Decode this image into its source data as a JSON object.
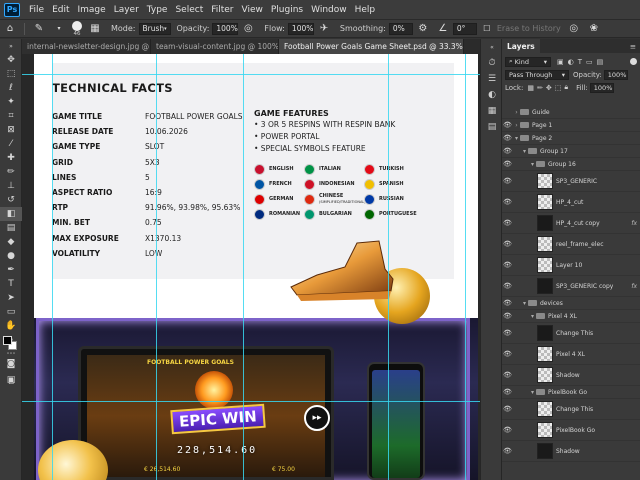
{
  "app": {
    "logo": "Ps"
  },
  "menu": [
    "File",
    "Edit",
    "Image",
    "Layer",
    "Type",
    "Select",
    "Filter",
    "View",
    "Plugins",
    "Window",
    "Help"
  ],
  "options": {
    "brush_size": "46",
    "mode_label": "Mode:",
    "mode_value": "Brush",
    "opacity_label": "Opacity:",
    "opacity_value": "100%",
    "flow_label": "Flow:",
    "flow_value": "100%",
    "smoothing_label": "Smoothing:",
    "smoothing_value": "0%",
    "angle_value": "0°",
    "erase_history": "Erase to History"
  },
  "tabs": [
    {
      "label": "internal-newsletter-design.jpg @ 100%..."
    },
    {
      "label": "team-visual-content.jpg @ 100% (RGB/..."
    },
    {
      "label": "Football Power Goals Game Sheet.psd @ 33.3% (RGB/16)"
    }
  ],
  "document": {
    "title": "TECHNICAL FACTS",
    "facts": [
      {
        "key": "GAME TITLE",
        "value": "FOOTBALL POWER GOALS"
      },
      {
        "key": "RELEASE DATE",
        "value": "10.06.2026"
      },
      {
        "key": "GAME TYPE",
        "value": "SLOT"
      },
      {
        "key": "GRID",
        "value": "5X3"
      },
      {
        "key": "LINES",
        "value": "5"
      },
      {
        "key": "ASPECT RATIO",
        "value": "16:9"
      },
      {
        "key": "RTP",
        "value": "91.96%, 93.98%, 95.63%"
      },
      {
        "key": "MIN. BET",
        "value": "0.75"
      },
      {
        "key": "MAX EXPOSURE",
        "value": "X1370.13"
      },
      {
        "key": "VOLATILITY",
        "value": "LOW"
      }
    ],
    "features_title": "GAME FEATURES",
    "features": [
      "• 3 OR 5 RESPINS WITH RESPIN BANK",
      "• POWER PORTAL",
      "• SPECIAL SYMBOLS FEATURE"
    ],
    "languages": [
      {
        "name": "ENGLISH",
        "color": "#c8102e"
      },
      {
        "name": "ITALIAN",
        "color": "#009246"
      },
      {
        "name": "TURKISH",
        "color": "#e30a17"
      },
      {
        "name": "FRENCH",
        "color": "#0055a4"
      },
      {
        "name": "INDONESIAN",
        "color": "#ce1126"
      },
      {
        "name": "SPANISH",
        "color": "#f1bf00"
      },
      {
        "name": "GERMAN",
        "color": "#dd0000"
      },
      {
        "name": "CHINESE",
        "color": "#de2910"
      },
      {
        "name": "RUSSIAN",
        "color": "#0039a6"
      },
      {
        "name": "ROMANIAN",
        "color": "#002b7f"
      },
      {
        "name": "BULGARIAN",
        "color": "#00966e"
      },
      {
        "name": "PORTUGUESE",
        "color": "#006600"
      }
    ],
    "chinese_sub": "(SIMPLIFIED/TRADITIONAL)",
    "game": {
      "logo_text": "FOOTBALL POWER GOALS",
      "epic_win": "EPIC WIN",
      "jackpot": "228,514.60",
      "bet_left": "€ 26,514.60",
      "bet_right": "€ 75.00"
    }
  },
  "layers_panel": {
    "tab": "Layers",
    "kind_label": "Kind",
    "blend_mode": "Pass Through",
    "opacity_label": "Opacity:",
    "opacity_value": "100%",
    "lock_label": "Lock:",
    "fill_label": "Fill:",
    "fill_value": "100%",
    "layers": [
      {
        "name": "Guide",
        "type": "folder",
        "indent": 0,
        "visible": false
      },
      {
        "name": "Page 1",
        "type": "folder",
        "indent": 0,
        "visible": true
      },
      {
        "name": "Page 2",
        "type": "folder",
        "indent": 0,
        "visible": true,
        "open": true
      },
      {
        "name": "Group 17",
        "type": "folder",
        "indent": 1,
        "visible": true,
        "open": true
      },
      {
        "name": "Group 16",
        "type": "folder",
        "indent": 2,
        "visible": true,
        "open": true
      },
      {
        "name": "SP3_GENERIC",
        "type": "thumb",
        "indent": 3,
        "visible": true
      },
      {
        "name": "HP_4_cut",
        "type": "thumb",
        "indent": 3,
        "visible": true
      },
      {
        "name": "HP_4_cut copy",
        "type": "thumb",
        "indent": 3,
        "visible": true,
        "fx": true
      },
      {
        "name": "reel_frame_elec",
        "type": "thumb",
        "indent": 3,
        "visible": true
      },
      {
        "name": "Layer 10",
        "type": "thumb",
        "indent": 3,
        "visible": true
      },
      {
        "name": "SP3_GENERIC copy",
        "type": "thumb",
        "indent": 3,
        "visible": true,
        "fx": true
      },
      {
        "name": "devices",
        "type": "folder",
        "indent": 1,
        "visible": true,
        "open": true
      },
      {
        "name": "Pixel 4 XL",
        "type": "folder",
        "indent": 2,
        "visible": true,
        "open": true
      },
      {
        "name": "Change This",
        "type": "thumb",
        "indent": 3,
        "visible": true
      },
      {
        "name": "Pixel 4 XL",
        "type": "thumb",
        "indent": 3,
        "visible": true
      },
      {
        "name": "Shadow",
        "type": "thumb",
        "indent": 3,
        "visible": true
      },
      {
        "name": "PixelBook Go",
        "type": "folder",
        "indent": 2,
        "visible": true,
        "open": true
      },
      {
        "name": "Change This",
        "type": "thumb",
        "indent": 3,
        "visible": true
      },
      {
        "name": "PixelBook Go",
        "type": "thumb",
        "indent": 3,
        "visible": true
      },
      {
        "name": "Shadow",
        "type": "thumb",
        "indent": 3,
        "visible": true
      }
    ]
  }
}
